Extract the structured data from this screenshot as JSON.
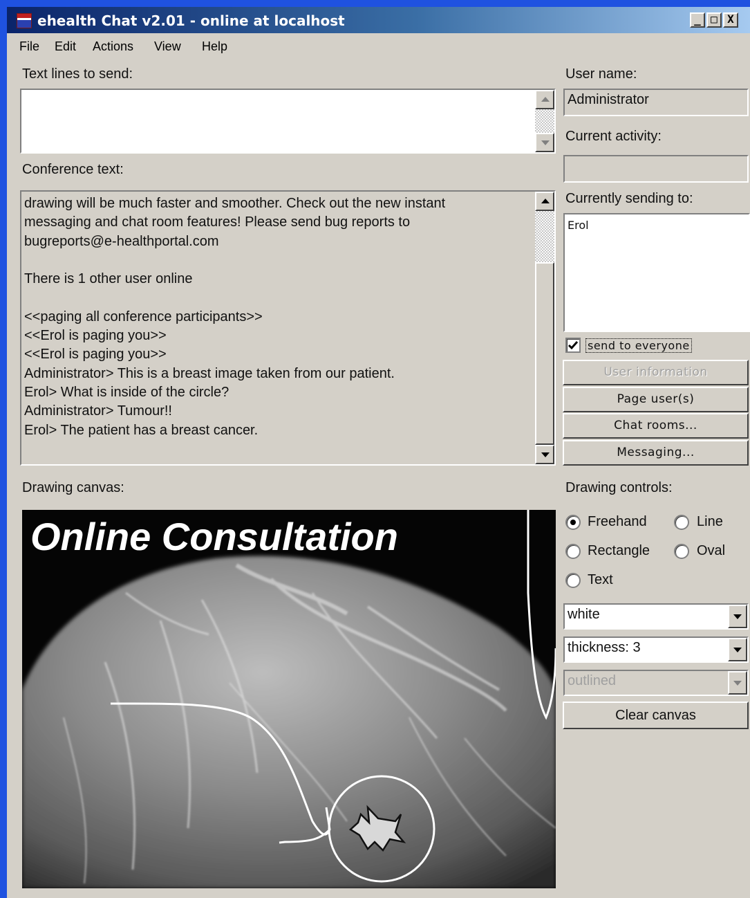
{
  "window": {
    "title": "ehealth Chat v2.01 - online at localhost",
    "minimize": "_",
    "maximize": "□",
    "close": "X"
  },
  "menu": [
    "File",
    "Edit",
    "Actions",
    "View",
    "Help"
  ],
  "labels": {
    "text_lines": "Text lines to send:",
    "conference": "Conference text:",
    "drawing_canvas": "Drawing canvas:",
    "user_name": "User name:",
    "current_activity": "Current activity:",
    "currently_sending": "Currently sending to:",
    "drawing_controls": "Drawing controls:"
  },
  "send_input": {
    "value": ""
  },
  "conference_lines": [
    "drawing will be much faster and smoother.  Check out the new instant",
    "messaging and chat room features!  Please send bug reports to",
    "bugreports@e-healthportal.com",
    "",
    "There is 1 other user online",
    "",
    "<<paging all conference participants>>",
    "<<Erol is paging you>>",
    "<<Erol is paging you>>",
    "Administrator> This is a breast image taken from our patient.",
    "Erol> What is inside of the circle?",
    "Administrator> Tumour!!",
    "Erol> The patient has a breast cancer."
  ],
  "user_name": "Administrator",
  "current_activity": "",
  "recipients": [
    "Erol"
  ],
  "send_to_everyone": {
    "label": "send to everyone",
    "checked": true
  },
  "buttons": {
    "user_information": "User information",
    "page_users": "Page user(s)",
    "chat_rooms": "Chat rooms...",
    "messaging": "Messaging...",
    "clear_canvas": "Clear canvas"
  },
  "drawing_modes": {
    "freehand": "Freehand",
    "line": "Line",
    "rectangle": "Rectangle",
    "oval": "Oval",
    "text": "Text",
    "selected": "Freehand"
  },
  "color_select": "white",
  "thickness_select": "thickness: 3",
  "fill_select": "outlined",
  "canvas": {
    "title": "Online Consultation"
  },
  "colors": {
    "title_bar": "#0a246a",
    "window_bg": "#d4d0c8",
    "desktop": "#1f52e0"
  }
}
